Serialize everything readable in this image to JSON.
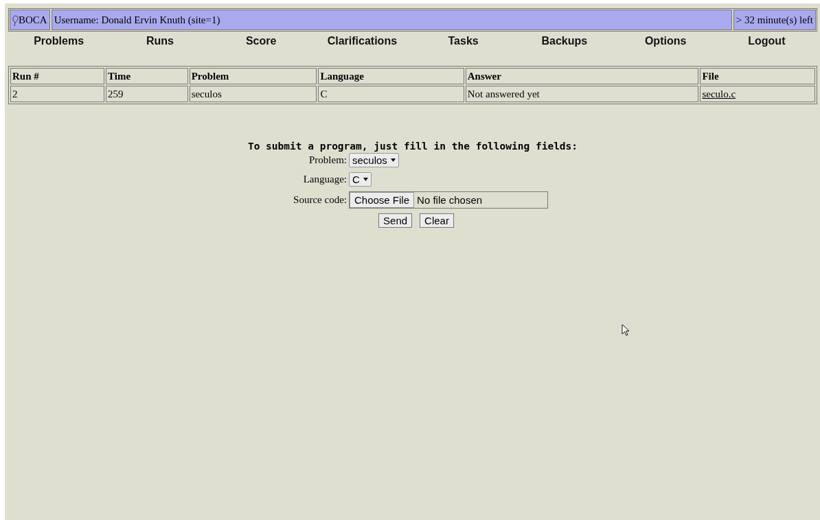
{
  "header": {
    "logo": "BOCA",
    "user": "Username: Donald Ervin Knuth (site=1)",
    "time_left": "> 32 minute(s) left"
  },
  "nav": [
    "Problems",
    "Runs",
    "Score",
    "Clarifications",
    "Tasks",
    "Backups",
    "Options",
    "Logout"
  ],
  "runs_table": {
    "columns": [
      "Run #",
      "Time",
      "Problem",
      "Language",
      "Answer",
      "File"
    ],
    "rows": [
      {
        "run": "2",
        "time": "259",
        "problem": "seculos",
        "language": "C",
        "answer": "Not answered yet",
        "file": "seculo.c"
      }
    ]
  },
  "form": {
    "heading": "To submit a program, just fill in the following fields:",
    "problem_label": "Problem:",
    "problem_value": "seculos",
    "language_label": "Language:",
    "language_value": "C",
    "source_label": "Source code:",
    "choose_button": "Choose File",
    "file_status": "No file chosen",
    "buttons": [
      "Send",
      "Clear"
    ]
  }
}
